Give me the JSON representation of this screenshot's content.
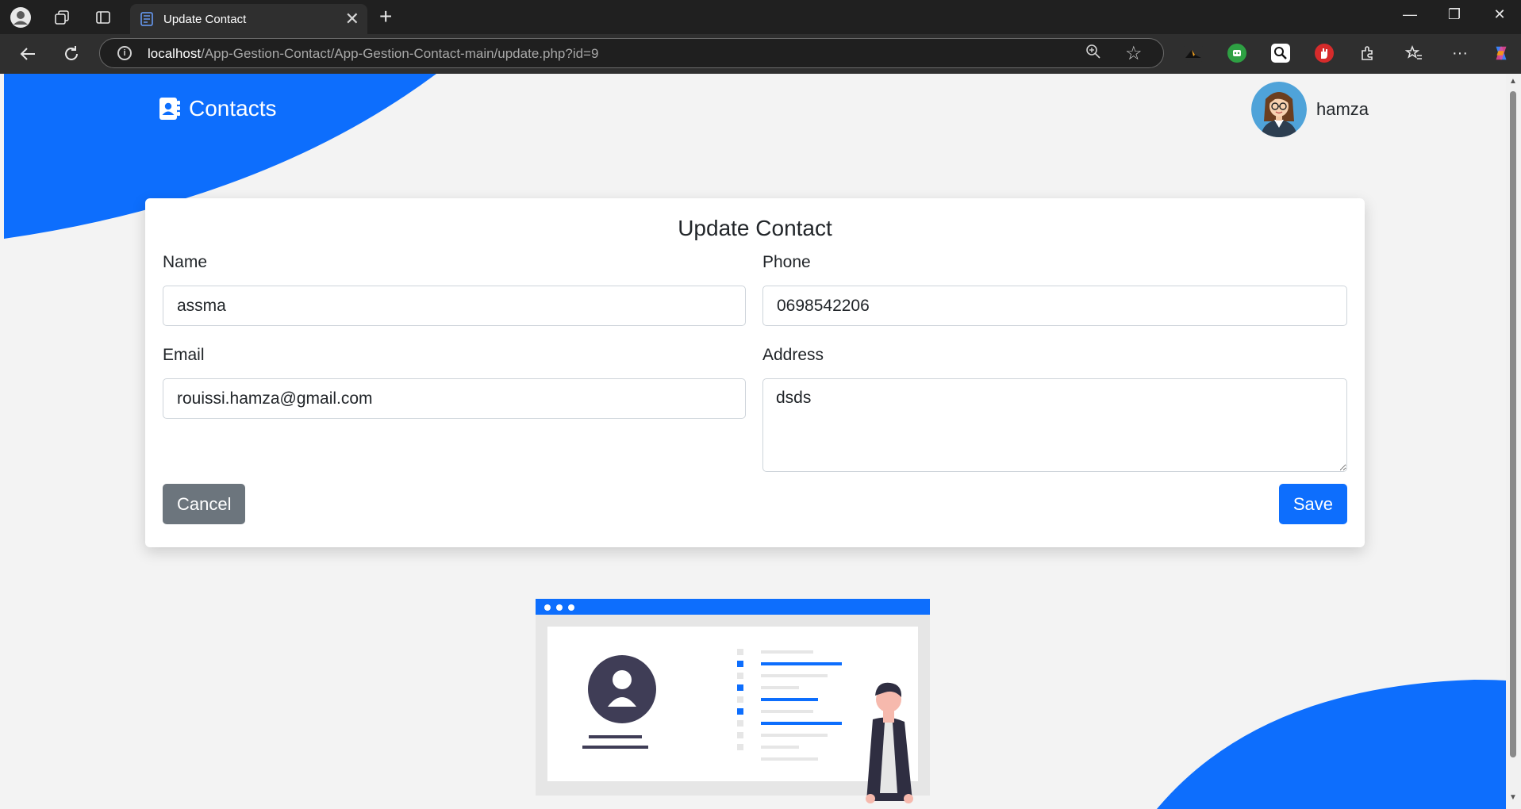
{
  "browser": {
    "tab_title": "Update Contact",
    "url_host": "localhost",
    "url_path": "/App-Gestion-Contact/App-Gestion-Contact-main/update.php?id=9"
  },
  "navbar": {
    "brand": "Contacts",
    "username": "hamza"
  },
  "form": {
    "title": "Update Contact",
    "name_label": "Name",
    "name_value": "assma",
    "phone_label": "Phone",
    "phone_value": "0698542206",
    "email_label": "Email",
    "email_value": "rouissi.hamza@gmail.com",
    "address_label": "Address",
    "address_value": "dsds",
    "cancel_label": "Cancel",
    "save_label": "Save"
  },
  "colors": {
    "primary": "#0d6efd",
    "secondary": "#6c757d",
    "dark_figure": "#3f3d56"
  }
}
